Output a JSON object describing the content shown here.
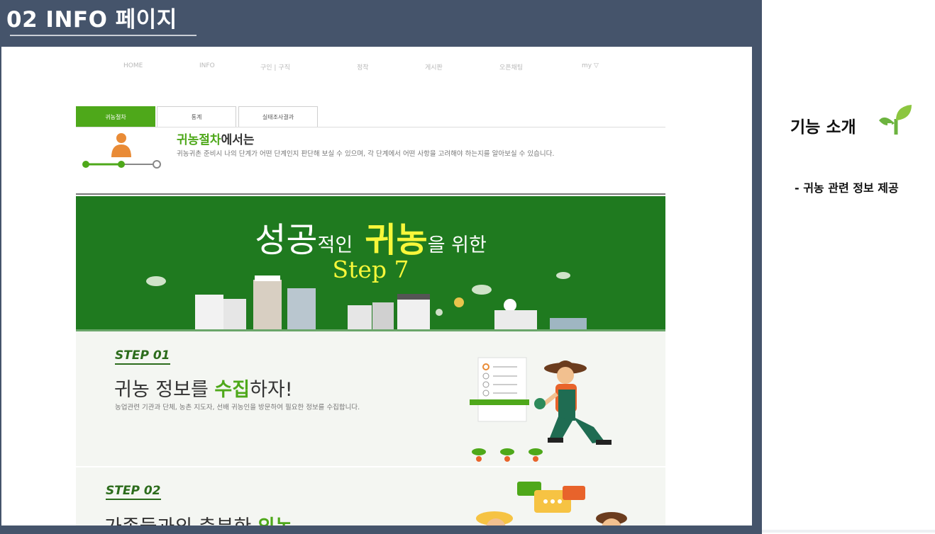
{
  "slide": {
    "title": "02 INFO 페이지"
  },
  "nav": {
    "items": [
      "HOME",
      "INFO",
      "구인 | 구직",
      "정착",
      "게시판",
      "오픈채팅",
      "my ▽"
    ]
  },
  "tabs": [
    {
      "label": "귀농절차",
      "active": true
    },
    {
      "label": "통계",
      "active": false
    },
    {
      "label": "실태조사결과",
      "active": false
    }
  ],
  "intro": {
    "title_highlight": "귀농절차",
    "title_rest": "에서는",
    "text": "귀농귀촌 준비시 나의 단계가 어떤 단계인지 판단해 보실 수 있으며, 각 단계에서 어떤 사항을 고려해야 하는지를 알아보실 수 있습니다."
  },
  "banner": {
    "word1": "성공",
    "word2": "적인",
    "word3": "귀농",
    "word4": "을 위한",
    "step": "Step 7"
  },
  "step1": {
    "label": "STEP 01",
    "heading_pre": "귀농 정보를 ",
    "heading_hl": "수집",
    "heading_post": "하자!",
    "desc": "농업관련 기관과 단체, 농촌 지도자, 선배 귀농인을 방문하여 필요한 정보를 수집합니다."
  },
  "step2": {
    "label": "STEP 02",
    "heading_pre": "가족들과의 충분한 ",
    "heading_hl": "의논"
  },
  "feature": {
    "title": "기능 소개",
    "item": "-  귀농 관련 정보 제공"
  },
  "colors": {
    "slide_bg": "#45546b",
    "accent_green": "#4ea81a",
    "banner_green": "#1f7a1f",
    "banner_yellow": "#f7f73a"
  }
}
